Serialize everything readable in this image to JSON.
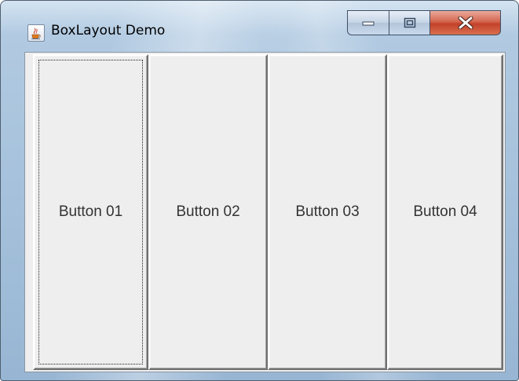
{
  "window": {
    "title": "BoxLayout Demo",
    "app_icon": "java-cup-icon",
    "caption_buttons": {
      "minimize_icon": "minimize-icon",
      "maximize_icon": "maximize-icon",
      "close_icon": "close-icon"
    }
  },
  "content": {
    "buttons": [
      {
        "label": "Button 01",
        "focused": true
      },
      {
        "label": "Button 02",
        "focused": false
      },
      {
        "label": "Button 03",
        "focused": false
      },
      {
        "label": "Button 04",
        "focused": false
      }
    ]
  },
  "colors": {
    "close_button": "#c7442c",
    "panel_background": "#eeeeee",
    "button_text": "#333333"
  }
}
